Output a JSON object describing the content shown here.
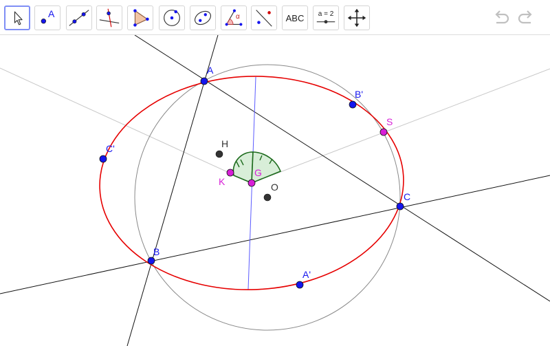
{
  "toolbar": {
    "tools": [
      {
        "name": "move-tool",
        "icon": "cursor-arrow-icon",
        "selected": true
      },
      {
        "name": "point-tool",
        "icon": "point-icon",
        "label": "A"
      },
      {
        "name": "line-tool",
        "icon": "line-through-two-points-icon"
      },
      {
        "name": "perpendicular-line-tool",
        "icon": "perpendicular-line-icon"
      },
      {
        "name": "polygon-tool",
        "icon": "polygon-icon"
      },
      {
        "name": "circle-center-point-tool",
        "icon": "circle-center-point-icon"
      },
      {
        "name": "conic-tool",
        "icon": "ellipse-icon"
      },
      {
        "name": "angle-tool",
        "icon": "angle-icon",
        "label": "α"
      },
      {
        "name": "reflect-tool",
        "icon": "reflect-about-line-icon"
      },
      {
        "name": "text-tool",
        "icon": "text-icon",
        "label": "ABC"
      },
      {
        "name": "slider-tool",
        "icon": "slider-icon",
        "label": "a = 2"
      },
      {
        "name": "move-graphics-view-tool",
        "icon": "move-arrows-icon"
      }
    ],
    "undo_icon": "undo-icon",
    "redo_icon": "redo-icon"
  },
  "colors": {
    "point_blue": "#1515ee",
    "point_magenta": "#d71fd7",
    "point_dark": "#333333",
    "ellipse_red": "#e60000",
    "circle_gray": "#888888",
    "line_black": "#111111",
    "line_light": "#c8c8c8",
    "line_blue": "#5a5aff",
    "angle_green": "#1d6b1d",
    "angle_fill": "#d8eed8"
  },
  "labels": {
    "A": "A",
    "B": "B",
    "C": "C",
    "A_prime": "A'",
    "B_prime": "B'",
    "C_prime": "C'",
    "H": "H",
    "G": "G",
    "K": "K",
    "O": "O",
    "S": "S"
  }
}
